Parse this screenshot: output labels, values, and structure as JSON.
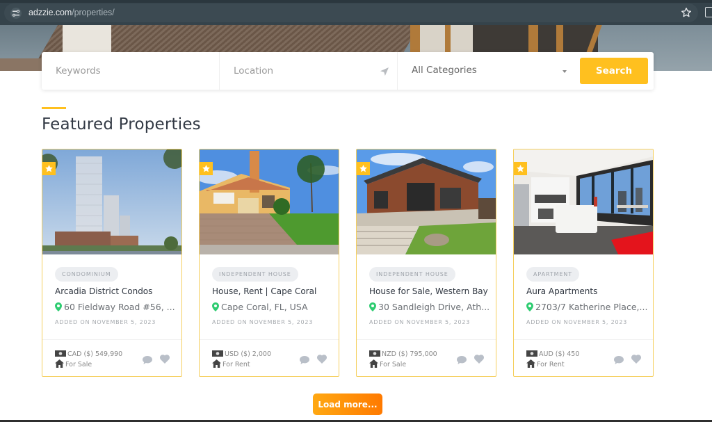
{
  "browser": {
    "url_domain": "adzzie.com",
    "url_path": "/properties/"
  },
  "search": {
    "keywords_placeholder": "Keywords",
    "location_placeholder": "Location",
    "category_selected": "All Categories",
    "search_label": "Search"
  },
  "section": {
    "title": "Featured Properties"
  },
  "colors": {
    "accent": "#ffc01f",
    "pin": "#2ecc71",
    "load_more_start": "#ffa812",
    "load_more_end": "#ff7a00"
  },
  "cards": [
    {
      "category": "CONDOMINIUM",
      "title": "Arcadia District Condos",
      "address": "60 Fieldway Road #56, ...",
      "added": "ADDED ON NOVEMBER 5, 2023",
      "price": "CAD ($) 549,990",
      "status": "For Sale",
      "featured": true
    },
    {
      "category": "INDEPENDENT HOUSE",
      "title": "House, Rent | Cape Coral",
      "address": "Cape Coral, FL, USA",
      "added": "ADDED ON NOVEMBER 5, 2023",
      "price": "USD ($) 2,000",
      "status": "For Rent",
      "featured": true
    },
    {
      "category": "INDEPENDENT HOUSE",
      "title": "House for Sale, Western Bay",
      "address": "30 Sandleigh Drive, Ath...",
      "added": "ADDED ON NOVEMBER 5, 2023",
      "price": "NZD ($) 795,000",
      "status": "For Sale",
      "featured": true
    },
    {
      "category": "APARTMENT",
      "title": "Aura Apartments",
      "address": "2703/7 Katherine Place,...",
      "added": "ADDED ON NOVEMBER 5, 2023",
      "price": "AUD ($) 450",
      "status": "For Rent",
      "featured": true
    }
  ],
  "load_more_label": "Load more..."
}
